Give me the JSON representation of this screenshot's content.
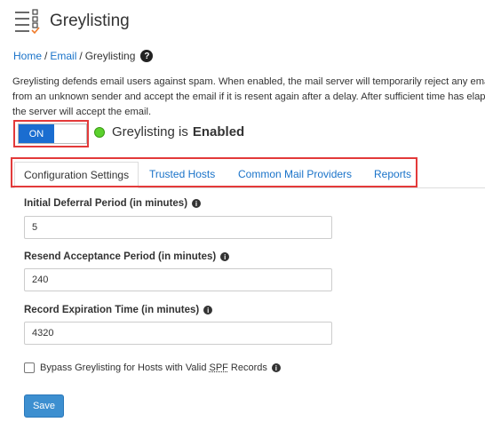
{
  "header": {
    "title": "Greylisting",
    "icon": "greylisting-list-icon"
  },
  "breadcrumb": {
    "home": "Home",
    "email": "Email",
    "current": "Greylisting",
    "help_icon": "?"
  },
  "description": "Greylisting defends email users against spam. When enabled, the mail server will temporarily reject any email from an unknown sender and accept the email if it is resent again after a delay. After sufficient time has elapsed, the server will accept the email.",
  "toggle": {
    "label": "ON",
    "state": "on",
    "highlight_color": "#e33a3a"
  },
  "status": {
    "prefix": "Greylisting is",
    "value": "Enabled",
    "indicator_color": "#5bd12d"
  },
  "tabs": [
    {
      "label": "Configuration Settings",
      "active": true
    },
    {
      "label": "Trusted Hosts",
      "active": false
    },
    {
      "label": "Common Mail Providers",
      "active": false
    },
    {
      "label": "Reports",
      "active": false
    }
  ],
  "fields": [
    {
      "label": "Initial Deferral Period (in minutes)",
      "value": "5"
    },
    {
      "label": "Resend Acceptance Period (in minutes)",
      "value": "240"
    },
    {
      "label": "Record Expiration Time (in minutes)",
      "value": "4320"
    }
  ],
  "bypass": {
    "label_before": "Bypass Greylisting for Hosts with Valid",
    "spf": "SPF",
    "label_after": "Records",
    "checked": false
  },
  "save_button": {
    "label": "Save",
    "color": "#3d8fd0"
  }
}
